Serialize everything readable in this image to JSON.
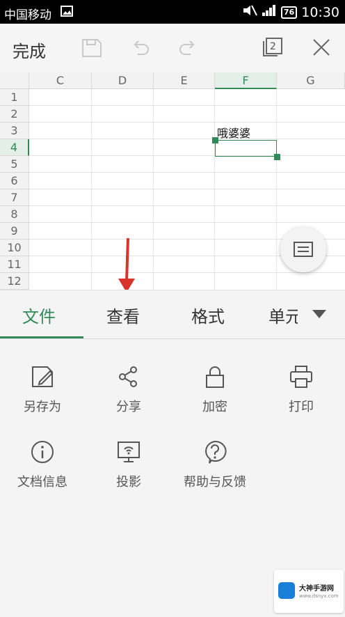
{
  "status": {
    "carrier": "中国移动",
    "battery": "76",
    "time": "10:30"
  },
  "toolbar": {
    "done_label": "完成",
    "window_count": "2"
  },
  "sheet": {
    "columns": [
      "C",
      "D",
      "E",
      "F",
      "G"
    ],
    "selected_column": "F",
    "rows": [
      "1",
      "2",
      "3",
      "4",
      "5",
      "6",
      "7",
      "8",
      "9",
      "10",
      "11",
      "12"
    ],
    "selected_row": "4",
    "cell_text": "哦婆婆"
  },
  "tabs": {
    "items": [
      "文件",
      "查看",
      "格式",
      "单元"
    ],
    "active": "文件"
  },
  "actions": [
    {
      "label": "另存为",
      "icon": "save-as-icon"
    },
    {
      "label": "分享",
      "icon": "share-icon"
    },
    {
      "label": "加密",
      "icon": "lock-icon"
    },
    {
      "label": "打印",
      "icon": "print-icon"
    },
    {
      "label": "文档信息",
      "icon": "info-icon"
    },
    {
      "label": "投影",
      "icon": "projection-icon"
    },
    {
      "label": "帮助与反馈",
      "icon": "help-icon"
    }
  ],
  "watermark": {
    "title": "大神手游网",
    "url": "www.dsnyx.com"
  },
  "colors": {
    "accent": "#2f8a57",
    "annotation_arrow": "#d9342b"
  }
}
